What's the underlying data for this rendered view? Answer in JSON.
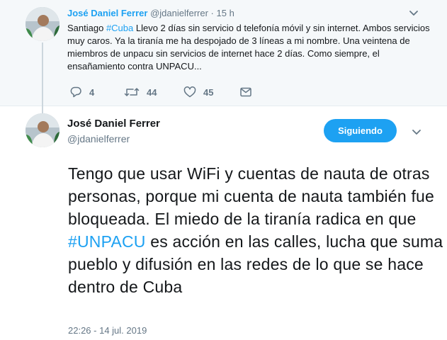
{
  "parent_tweet": {
    "author_name": "José Daniel Ferrer",
    "handle": "@jdanielferrer",
    "separator": "·",
    "time": "15 h",
    "text_before": "Santiago ",
    "hashtag": "#Cuba",
    "text_after": " Llevo 2 días sin servicio d telefonía móvil y sin internet. Ambos servicios muy caros. Ya la tiranía me ha despojado de 3 líneas a mi nombre. Una veintena de miembros de unpacu sin servicios de internet hace 2 días. Como siempre, el ensañamiento contra UNPACU...",
    "replies_count": "4",
    "retweets_count": "44",
    "likes_count": "45",
    "icons": [
      "reply-icon",
      "retweet-icon",
      "like-icon",
      "message-icon",
      "chevron-down-icon"
    ]
  },
  "main_tweet": {
    "author_name": "José Daniel Ferrer",
    "handle": "@jdanielferrer",
    "follow_label": "Siguiendo",
    "text_before": "Tengo que usar WiFi y cuentas de nauta de otras personas, porque mi cuenta de nauta también fue bloqueada. El miedo de la tiranía radica en que ",
    "hashtag": "#UNPACU",
    "text_after": " es acción en las calles, lucha que suma pueblo y difusión en las redes de lo que se hace dentro de Cuba",
    "timestamp": "22:26 - 14 jul. 2019"
  },
  "colors": {
    "accent": "#1da1f2",
    "muted": "#657786",
    "parent_background": "#f5f8fa"
  }
}
